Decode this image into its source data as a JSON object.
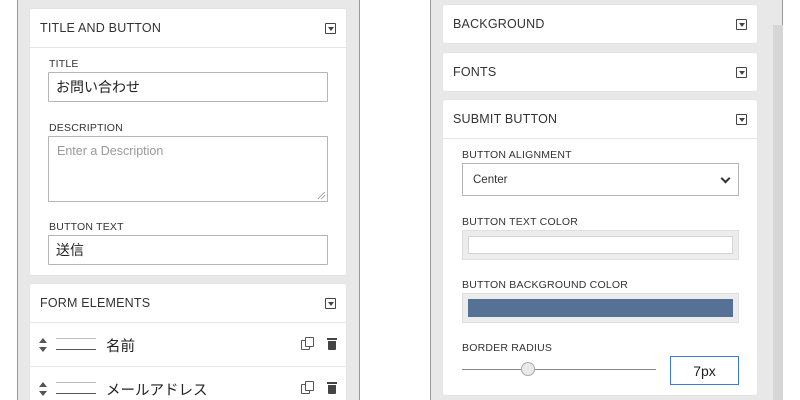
{
  "left": {
    "title_section": {
      "header": "TITLE AND BUTTON",
      "title_label": "TITLE",
      "title_value": "お問い合わせ",
      "description_label": "DESCRIPTION",
      "description_placeholder": "Enter a Description",
      "button_text_label": "BUTTON TEXT",
      "button_text_value": "送信"
    },
    "form_elements": {
      "header": "FORM ELEMENTS",
      "items": [
        {
          "label": "名前",
          "icon": "text-field-icon"
        },
        {
          "label": "メールアドレス",
          "icon": "email-field-icon"
        }
      ]
    }
  },
  "right": {
    "background_header": "BACKGROUND",
    "fonts_header": "FONTS",
    "submit_button": {
      "header": "SUBMIT BUTTON",
      "alignment_label": "BUTTON ALIGNMENT",
      "alignment_value": "Center",
      "text_color_label": "BUTTON TEXT COLOR",
      "text_color": "#ffffff",
      "bg_color_label": "BUTTON BACKGROUND COLOR",
      "bg_color": "#557296",
      "border_radius_label": "BORDER RADIUS",
      "border_radius_value": "7px",
      "border_radius_slider_fraction": 0.34
    }
  }
}
